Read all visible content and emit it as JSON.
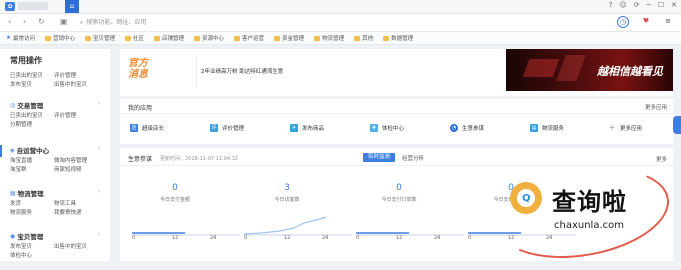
{
  "topbar": {
    "home_icon": "home-icon",
    "window_controls": [
      "?",
      "☺",
      "⟳",
      "─",
      "☐",
      "✕"
    ]
  },
  "nav": {
    "address_placeholder": "搜索功能、网址、应用"
  },
  "bookmarks": [
    {
      "label": "最常访问",
      "type": "star"
    },
    {
      "label": "营销中心",
      "type": "folder"
    },
    {
      "label": "宝贝管理",
      "type": "folder"
    },
    {
      "label": "社区",
      "type": "folder"
    },
    {
      "label": "店铺管理",
      "type": "folder"
    },
    {
      "label": "资源中心",
      "type": "folder"
    },
    {
      "label": "客户运营",
      "type": "folder"
    },
    {
      "label": "资金管理",
      "type": "folder"
    },
    {
      "label": "物流管理",
      "type": "folder"
    },
    {
      "label": "其他",
      "type": "folder"
    },
    {
      "label": "数据管理",
      "type": "folder"
    }
  ],
  "sidebar": {
    "title": "常用操作",
    "quick_links": [
      "已卖出的宝贝",
      "评价管理",
      "发布宝贝",
      "出售中的宝贝"
    ],
    "sections": [
      {
        "label": "交易管理",
        "icon": "trade-icon",
        "links": [
          "已卖出的宝贝",
          "评价管理",
          "分期管理"
        ]
      },
      {
        "label": "自运营中心",
        "icon": "operation-icon",
        "links": [
          "淘宝直播",
          "微淘内容管理",
          "淘宝群",
          "商家短视频"
        ]
      },
      {
        "label": "物流管理",
        "icon": "logistics-icon",
        "links": [
          "发货",
          "物流工具",
          "物流服务",
          "我要寄快递"
        ]
      },
      {
        "label": "宝贝管理",
        "icon": "goods-icon",
        "links": [
          "发布宝贝",
          "出售中的宝贝",
          "体检中心"
        ]
      }
    ]
  },
  "banner": {
    "announcement_title": "官方消息",
    "announcement_text": "2年业绩高万粉 助达特红通湾生意",
    "promo_slogan": "越相信越看见"
  },
  "my_apps": {
    "title": "我的应用",
    "more": "更多应用",
    "items": [
      {
        "label": "超级店长",
        "icon": "shop-icon"
      },
      {
        "label": "评价管理",
        "icon": "review-icon"
      },
      {
        "label": "发布商品",
        "icon": "publish-icon"
      },
      {
        "label": "体检中心",
        "icon": "checkup-icon"
      },
      {
        "label": "生意参谋",
        "icon": "analytics-icon"
      },
      {
        "label": "物流服务",
        "icon": "logistics-icon"
      },
      {
        "label": "更多应用",
        "icon": "plus-icon"
      }
    ]
  },
  "business": {
    "title": "生意参谋",
    "update_time": "更新时间：2018-11-07 11:04:32",
    "tab_active": "实时监测",
    "tab_other": "经营分析",
    "more": "更多",
    "metrics": [
      {
        "value": "0",
        "label": "今日支付金额"
      },
      {
        "value": "3",
        "label": "今日访客数"
      },
      {
        "value": "0",
        "label": "今日支付订单数"
      },
      {
        "value": "0",
        "label": "今日支付转化率"
      }
    ],
    "axis_ticks": [
      "0",
      "12",
      "24"
    ]
  },
  "watermark": {
    "cn": "查询啦",
    "en": "chaxunla.com"
  }
}
